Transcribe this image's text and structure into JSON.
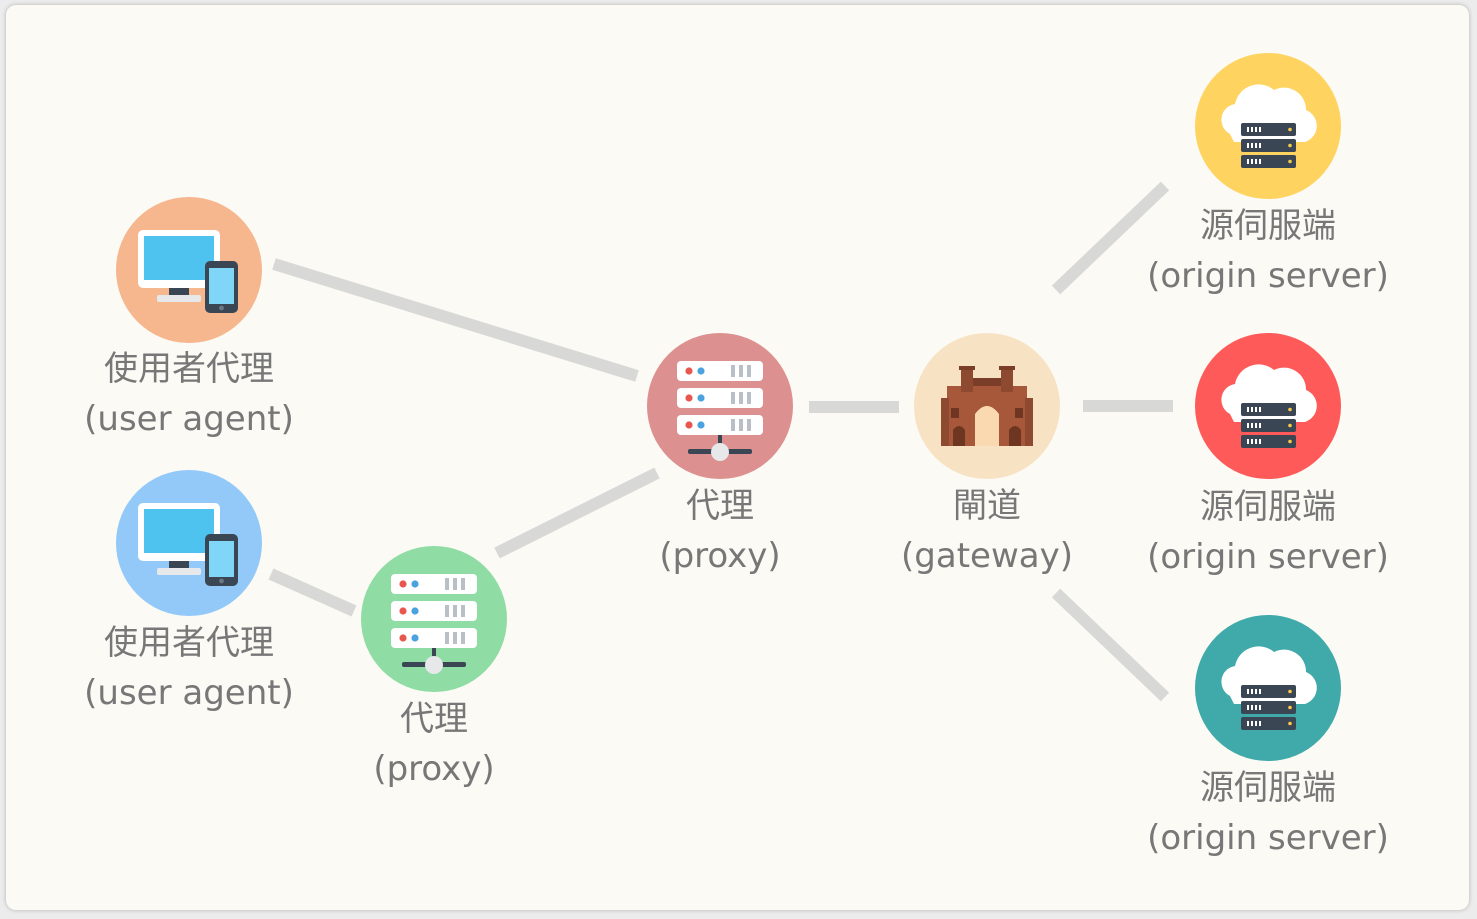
{
  "nodes": {
    "user_agent_1": {
      "label_zh": "使用者代理",
      "label_en": "(user agent)",
      "color": "#f6b68e"
    },
    "user_agent_2": {
      "label_zh": "使用者代理",
      "label_en": "(user agent)",
      "color": "#93c9f8"
    },
    "proxy_1": {
      "label_zh": "代理",
      "label_en": "(proxy)",
      "color": "#dd9090"
    },
    "proxy_2": {
      "label_zh": "代理",
      "label_en": "(proxy)",
      "color": "#8fdca4"
    },
    "gateway": {
      "label_zh": "閘道",
      "label_en": "(gateway)",
      "color": "#f7e3c3"
    },
    "origin_1": {
      "label_zh": "源伺服端",
      "label_en": "(origin server)",
      "color": "#fed35f"
    },
    "origin_2": {
      "label_zh": "源伺服端",
      "label_en": "(origin server)",
      "color": "#fd5a59"
    },
    "origin_3": {
      "label_zh": "源伺服端",
      "label_en": "(origin server)",
      "color": "#40a9a9"
    }
  },
  "connectors": [
    {
      "from": "user_agent_1",
      "to": "proxy_1"
    },
    {
      "from": "user_agent_2",
      "to": "proxy_2"
    },
    {
      "from": "proxy_2",
      "to": "proxy_1"
    },
    {
      "from": "proxy_1",
      "to": "gateway"
    },
    {
      "from": "gateway",
      "to": "origin_1"
    },
    {
      "from": "gateway",
      "to": "origin_2"
    },
    {
      "from": "gateway",
      "to": "origin_3"
    }
  ],
  "colors": {
    "connector": "#d8d8d6",
    "label_text": "#777777",
    "background": "#fbfaf4"
  }
}
